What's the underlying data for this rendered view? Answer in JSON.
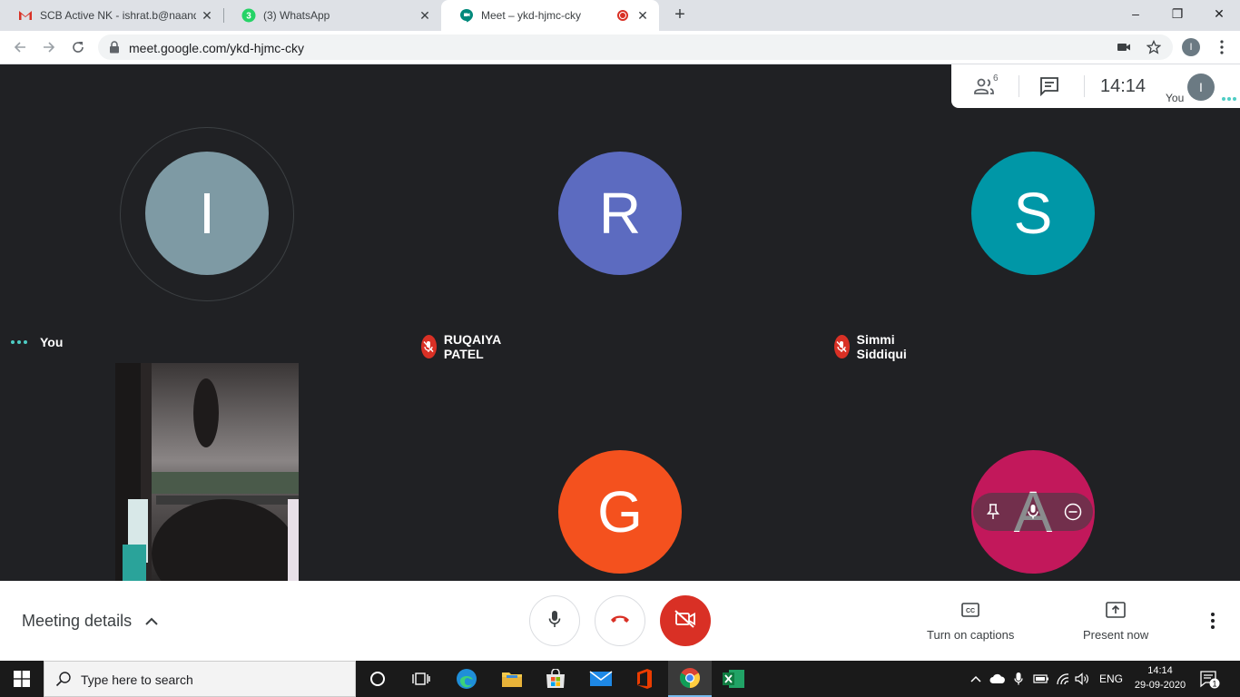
{
  "browser": {
    "tabs": [
      {
        "title": "SCB Active NK - ishrat.b@naandi",
        "close": "✕"
      },
      {
        "title": "(3) WhatsApp",
        "badge": "3",
        "close": "✕"
      },
      {
        "title": "Meet – ykd-hjmc-cky",
        "close": "✕"
      }
    ],
    "new_tab": "+",
    "window_controls": [
      "–",
      "❐",
      "✕"
    ],
    "url": "meet.google.com/ykd-hjmc-cky",
    "profile_initial": "I"
  },
  "meet": {
    "info_panel": {
      "people_count": "6",
      "time": "14:14",
      "you_label": "You",
      "self_initial": "I"
    },
    "participants": [
      {
        "initial": "I",
        "name": "You",
        "color": "#7e9aa4"
      },
      {
        "initial": "R",
        "name": "RUQAIYA PATEL",
        "color": "#5c6bc0"
      },
      {
        "initial": "S",
        "name": "Simmi Siddiqui",
        "color": "#0097a7"
      },
      {
        "initial": "G",
        "color": "#f4511e"
      },
      {
        "initial": "A",
        "color": "#c2185b"
      }
    ],
    "bottom": {
      "meeting_details": "Meeting details",
      "captions_label": "Turn on captions",
      "present_label": "Present now"
    }
  },
  "taskbar": {
    "search_placeholder": "Type here to search",
    "language": "ENG",
    "time": "14:14",
    "date": "29-09-2020",
    "notification_count": "1"
  },
  "colors": {
    "meet_background": "#202124",
    "danger_red": "#d93025",
    "active_speaker": "#4ecdc4"
  }
}
